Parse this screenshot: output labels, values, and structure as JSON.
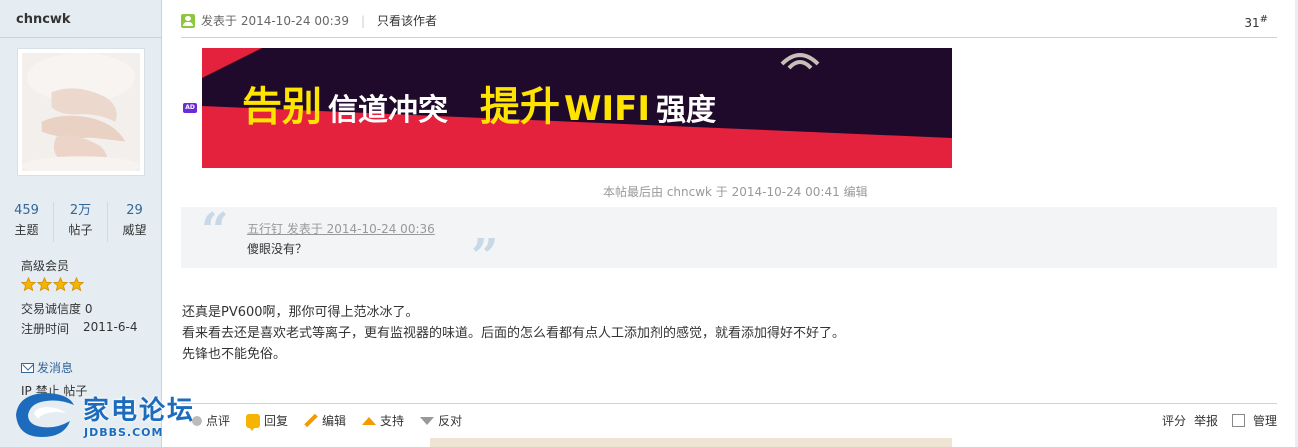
{
  "author": {
    "name": "chncwk",
    "stats": [
      {
        "value": "459",
        "label": "主题"
      },
      {
        "value": "2万",
        "label": "帖子"
      },
      {
        "value": "29",
        "label": "威望"
      }
    ],
    "rank": "高级会员",
    "stars": 4,
    "trust": "交易诚信度 0",
    "reg_label": "注册时间",
    "reg_date": "2011-6-4",
    "send_message": "发消息",
    "ip_ban": "IP 禁止 帖子"
  },
  "logo": {
    "text": "家电论坛",
    "sub": "JDBBS.COM"
  },
  "post": {
    "posted": "发表于 2014-10-24 00:39",
    "only_author": "只看该作者",
    "floor": "31",
    "floor_mark": "#",
    "ad_badge": "AD",
    "banner": {
      "part1": "告别",
      "part2": "信道冲突",
      "part3": "提升",
      "part4": "WIFI",
      "part5": "强度"
    },
    "edited": "本帖最后由 chncwk 于 2014-10-24 00:41 编辑",
    "quote": {
      "header": "五行钉 发表于 2014-10-24 00:36",
      "body": "傻眼没有？"
    },
    "lines": [
      "还真是PV600啊，那你可得上范冰冰了。",
      "看来看去还是喜欢老式等离子，更有监视器的味道。后面的怎么看都有点人工添加剂的感觉，就看添加得好不好了。",
      "先锋也不能免俗。"
    ]
  },
  "actions": {
    "rate": "点评",
    "reply": "回复",
    "edit": "编辑",
    "support": "支持",
    "oppose": "反对"
  },
  "right_actions": {
    "score": "评分",
    "report": "举报",
    "manage": "管理"
  },
  "colors": {
    "accent": "#369",
    "sidebar_bg": "#e5edf2",
    "banner_red": "#e5223d",
    "banner_dark": "#1f0a2b",
    "banner_yellow": "#ffe400"
  }
}
